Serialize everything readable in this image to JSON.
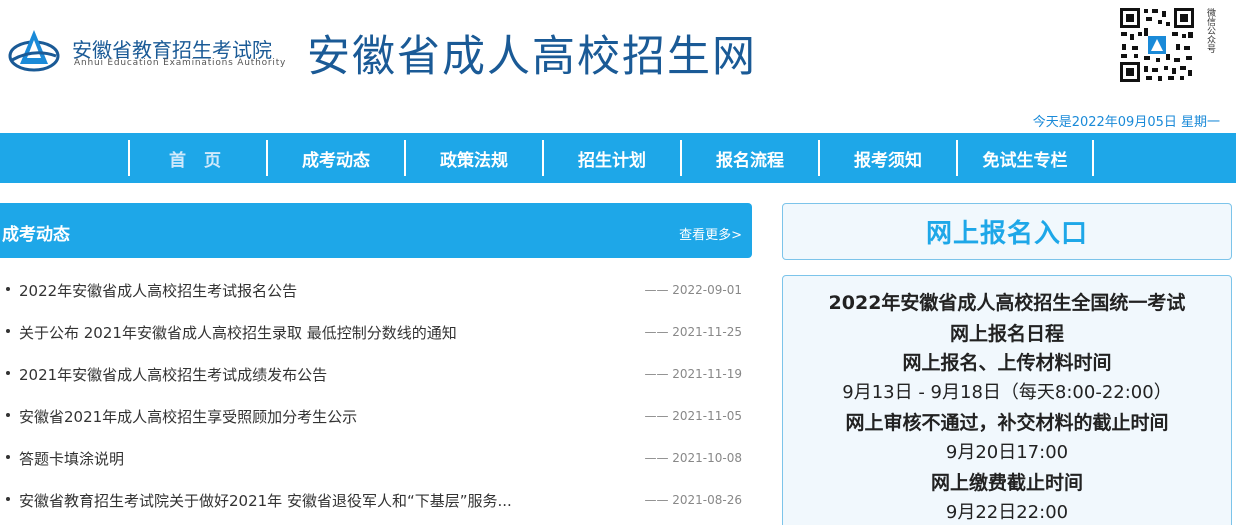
{
  "header": {
    "org_name_cn": "安徽省教育招生考试院",
    "org_name_en": "Anhui Education Examinations Authority",
    "site_title": "安徽省成人高校招生网",
    "qr_caption": "微信公众号",
    "date_text": "今天是2022年09月05日 星期一"
  },
  "nav": {
    "items": [
      {
        "label": "首 页"
      },
      {
        "label": "成考动态"
      },
      {
        "label": "政策法规"
      },
      {
        "label": "招生计划"
      },
      {
        "label": "报名流程"
      },
      {
        "label": "报考须知"
      },
      {
        "label": "免试生专栏"
      }
    ]
  },
  "news": {
    "title": "成考动态",
    "more": "查看更多>",
    "items": [
      {
        "text": "2022年安徽省成人高校招生考试报名公告",
        "date": "—— 2022-09-01"
      },
      {
        "text": "关于公布 2021年安徽省成人高校招生录取 最低控制分数线的通知",
        "date": "—— 2021-11-25"
      },
      {
        "text": "2021年安徽省成人高校招生考试成绩发布公告",
        "date": "—— 2021-11-19"
      },
      {
        "text": "安徽省2021年成人高校招生享受照顾加分考生公示",
        "date": "—— 2021-11-05"
      },
      {
        "text": "答题卡填涂说明",
        "date": "—— 2021-10-08"
      },
      {
        "text": "安徽省教育招生考试院关于做好2021年 安徽省退役军人和“下基层”服务...",
        "date": "—— 2021-08-26"
      }
    ]
  },
  "entry": {
    "label": "网上报名入口"
  },
  "schedule": {
    "title_line1": "2022年安徽省成人高校招生全国统一考试",
    "title_line2": "网上报名日程",
    "h1": "网上报名、上传材料时间",
    "v1": "9月13日 - 9月18日（每天8:00-22:00）",
    "h2": "网上审核不通过，补交材料的截止时间",
    "v2": "9月20日17:00",
    "h3": "网上缴费截止时间",
    "v3": "9月22日22:00"
  },
  "colors": {
    "brand_blue": "#1ea7e8",
    "title_blue": "#1a5a96"
  }
}
